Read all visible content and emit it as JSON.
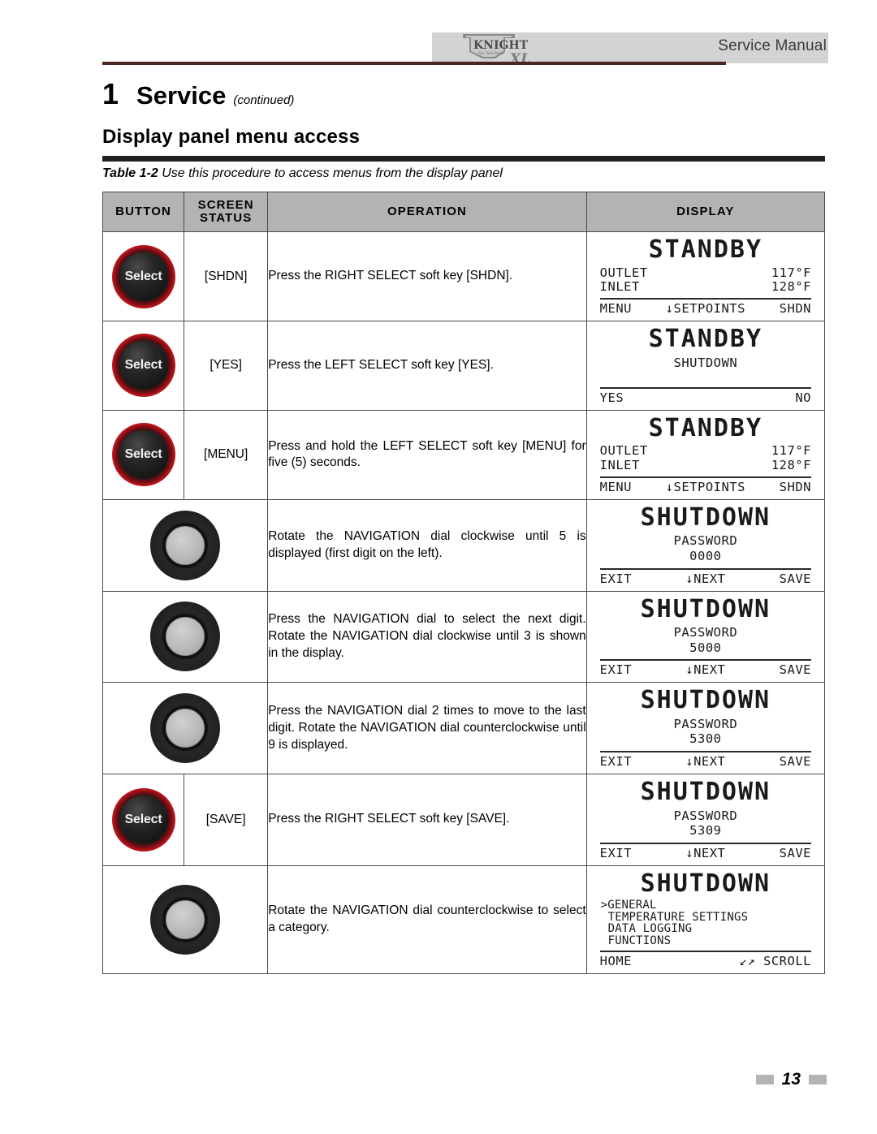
{
  "header": {
    "manual_label": "Service Manual",
    "logo_name": "KNIGHT XL",
    "logo_top": "KNIGHT",
    "logo_sub": "XL"
  },
  "chapter": {
    "number": "1",
    "word": "Service",
    "continued": "(continued)"
  },
  "section_title": "Display panel menu access",
  "table_caption": {
    "label": "Table 1-2",
    "text": " Use this procedure to access menus from the display panel"
  },
  "table": {
    "columns": [
      "BUTTON",
      "SCREEN STATUS",
      "OPERATION",
      "DISPLAY"
    ],
    "column_button": "BUTTON",
    "column_status_line1": "SCREEN",
    "column_status_line2": "STATUS",
    "column_operation": "OPERATION",
    "column_display": "DISPLAY",
    "rows": [
      {
        "button": "select-button",
        "button_label": "Select",
        "status": "[SHDN]",
        "operation": "Press the RIGHT SELECT soft key [SHDN].",
        "screen": {
          "title": "STANDBY",
          "type": "status",
          "lines": [
            {
              "left": "OUTLET",
              "right": "117°F"
            },
            {
              "left": "INLET",
              "right": "128°F"
            }
          ],
          "softkeys": [
            "MENU",
            "↓SETPOINTS",
            "SHDN"
          ]
        }
      },
      {
        "button": "select-button",
        "button_label": "Select",
        "status": "[YES]",
        "operation": "Press the LEFT SELECT soft key [YES].",
        "screen": {
          "title": "STANDBY",
          "type": "confirm",
          "center": [
            "SHUTDOWN"
          ],
          "softkeys": [
            "YES",
            "NO"
          ]
        }
      },
      {
        "button": "select-button",
        "button_label": "Select",
        "status": "[MENU]",
        "operation": "Press and hold the LEFT SELECT soft key [MENU] for five (5) seconds.",
        "screen": {
          "title": "STANDBY",
          "type": "status",
          "lines": [
            {
              "left": "OUTLET",
              "right": "117°F"
            },
            {
              "left": "INLET",
              "right": "128°F"
            }
          ],
          "softkeys": [
            "MENU",
            "↓SETPOINTS",
            "SHDN"
          ]
        }
      },
      {
        "button": "nav-dial",
        "status": "",
        "merged": true,
        "operation": "Rotate the NAVIGATION dial clockwise until 5 is displayed (first digit on the left).",
        "screen": {
          "title": "SHUTDOWN",
          "type": "password",
          "center": [
            "PASSWORD",
            "0000"
          ],
          "softkeys": [
            "EXIT",
            "↓NEXT",
            "SAVE"
          ]
        }
      },
      {
        "button": "nav-dial",
        "status": "",
        "merged": true,
        "operation": "Press the NAVIGATION dial to select the next digit. Rotate the NAVIGATION dial clockwise until 3 is shown in the display.",
        "screen": {
          "title": "SHUTDOWN",
          "type": "password",
          "center": [
            "PASSWORD",
            "5000"
          ],
          "softkeys": [
            "EXIT",
            "↓NEXT",
            "SAVE"
          ]
        }
      },
      {
        "button": "nav-dial",
        "status": "",
        "merged": true,
        "operation": "Press the NAVIGATION dial 2 times to move to the last digit.  Rotate the NAVIGATION dial counterclockwise until 9 is displayed.",
        "screen": {
          "title": "SHUTDOWN",
          "type": "password",
          "center": [
            "PASSWORD",
            "5300"
          ],
          "softkeys": [
            "EXIT",
            "↓NEXT",
            "SAVE"
          ]
        }
      },
      {
        "button": "select-button",
        "button_label": "Select",
        "status": "[SAVE]",
        "operation": "Press the RIGHT SELECT soft key [SAVE].",
        "screen": {
          "title": "SHUTDOWN",
          "type": "password",
          "center": [
            "PASSWORD",
            "5309"
          ],
          "softkeys": [
            "EXIT",
            "↓NEXT",
            "SAVE"
          ]
        }
      },
      {
        "button": "nav-dial",
        "status": "",
        "merged": true,
        "operation": "Rotate the NAVIGATION dial counterclockwise to select a category.",
        "screen": {
          "title": "SHUTDOWN",
          "type": "menu",
          "menu_items": [
            {
              "text": "GENERAL",
              "selected": true
            },
            {
              "text": "TEMPERATURE SETTINGS",
              "selected": false
            },
            {
              "text": "DATA LOGGING",
              "selected": false
            },
            {
              "text": "FUNCTIONS",
              "selected": false
            }
          ],
          "softkeys": [
            "HOME",
            "↙↗ SCROLL"
          ]
        }
      }
    ]
  },
  "footer": {
    "page_number": "13"
  },
  "colors": {
    "header_band": "#d2d3d5",
    "table_header": "#b3b3b6",
    "rule_dark": "#231f20",
    "rule_maroon": "#4a2522",
    "button_red": "#c2161d"
  }
}
